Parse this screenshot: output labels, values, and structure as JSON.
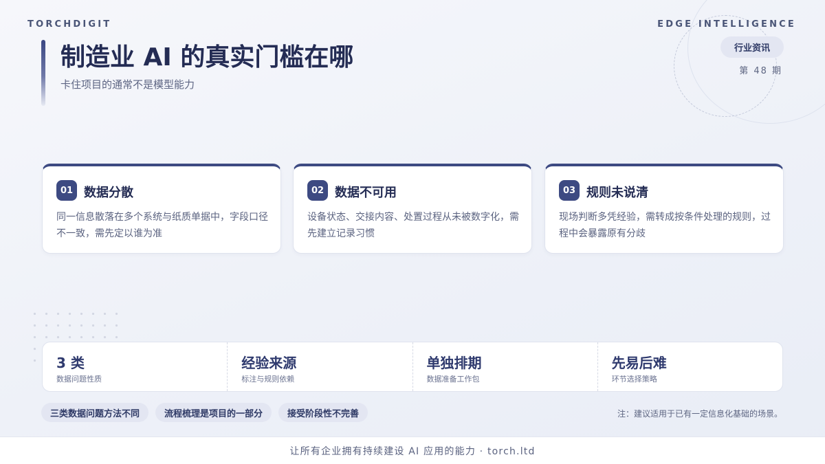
{
  "brand": "TORCHDIGIT",
  "edge_label": "EDGE INTELLIGENCE",
  "tag": "行业资讯",
  "issue": "第 48 期",
  "title": "制造业 AI 的真实门槛在哪",
  "subtitle": "卡住项目的通常不是模型能力",
  "cards": [
    {
      "num": "01",
      "title": "数据分散",
      "body": "同一信息散落在多个系统与纸质单据中，字段口径不一致，需先定以谁为准"
    },
    {
      "num": "02",
      "title": "数据不可用",
      "body": "设备状态、交接内容、处置过程从未被数字化，需先建立记录习惯"
    },
    {
      "num": "03",
      "title": "规则未说清",
      "body": "现场判断多凭经验，需转成按条件处理的规则，过程中会暴露原有分歧"
    }
  ],
  "stats": [
    {
      "value": "3 类",
      "label": "数据问题性质"
    },
    {
      "value": "经验来源",
      "label": "标注与规则依赖"
    },
    {
      "value": "单独排期",
      "label": "数据准备工作包"
    },
    {
      "value": "先易后难",
      "label": "环节选择策略"
    }
  ],
  "chips": [
    "三类数据问题方法不同",
    "流程梳理是项目的一部分",
    "接受阶段性不完善"
  ],
  "note": "注：建议适用于已有一定信息化基础的场景。",
  "footer": "让所有企业拥有持续建设 AI 应用的能力 · torch.ltd",
  "colors": {
    "accent": "#3d4a82",
    "title": "#242c54",
    "background": "#eef1f8"
  }
}
